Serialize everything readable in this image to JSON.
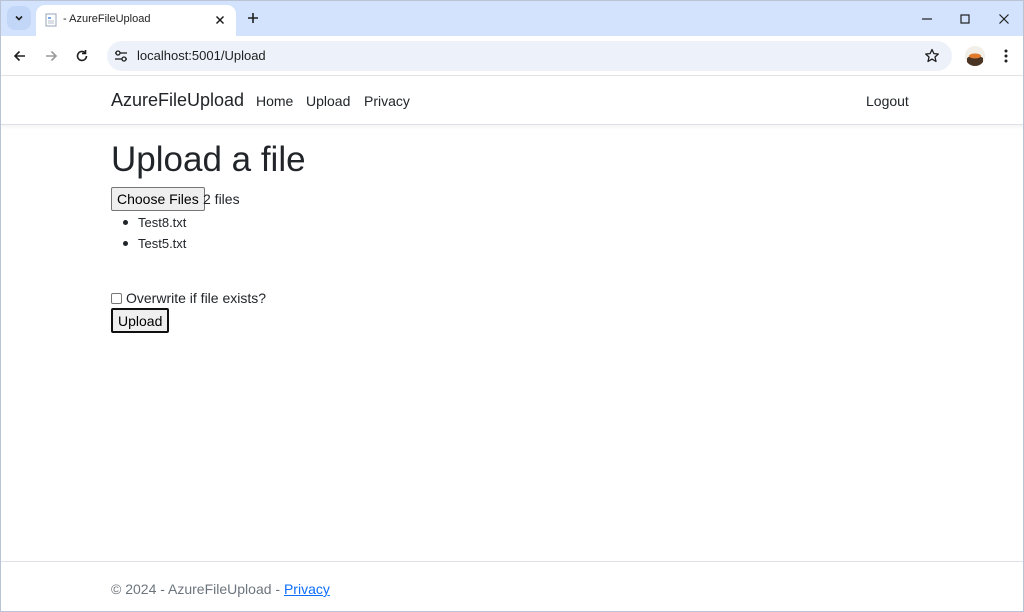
{
  "browser": {
    "tab_title": "- AzureFileUpload",
    "url": "localhost:5001/Upload"
  },
  "icons": {
    "tab_search": "chevron-down-icon",
    "favicon": "document-icon",
    "tab_close": "close-icon",
    "new_tab": "plus-icon",
    "minimize": "minimize-icon",
    "maximize": "maximize-icon",
    "close": "close-icon",
    "back": "arrow-left-icon",
    "forward": "arrow-right-icon",
    "reload": "reload-icon",
    "site_info": "tune-icon",
    "bookmark": "star-icon",
    "menu": "more-vertical-icon"
  },
  "navbar": {
    "brand": "AzureFileUpload",
    "links": [
      "Home",
      "Upload",
      "Privacy"
    ],
    "logout": "Logout"
  },
  "main": {
    "heading": "Upload a file",
    "choose_label": "Choose Files",
    "file_count": "2 files",
    "files": [
      "Test8.txt",
      "Test5.txt"
    ],
    "overwrite_label": "Overwrite if file exists?",
    "upload_label": "Upload"
  },
  "footer": {
    "text": "© 2024 - AzureFileUpload - ",
    "link": "Privacy"
  },
  "colors": {
    "tabstrip": "#d3e3fd",
    "omnibox": "#edf2fa",
    "text": "#212529",
    "muted": "#6c757d",
    "link": "#0d6efd"
  }
}
